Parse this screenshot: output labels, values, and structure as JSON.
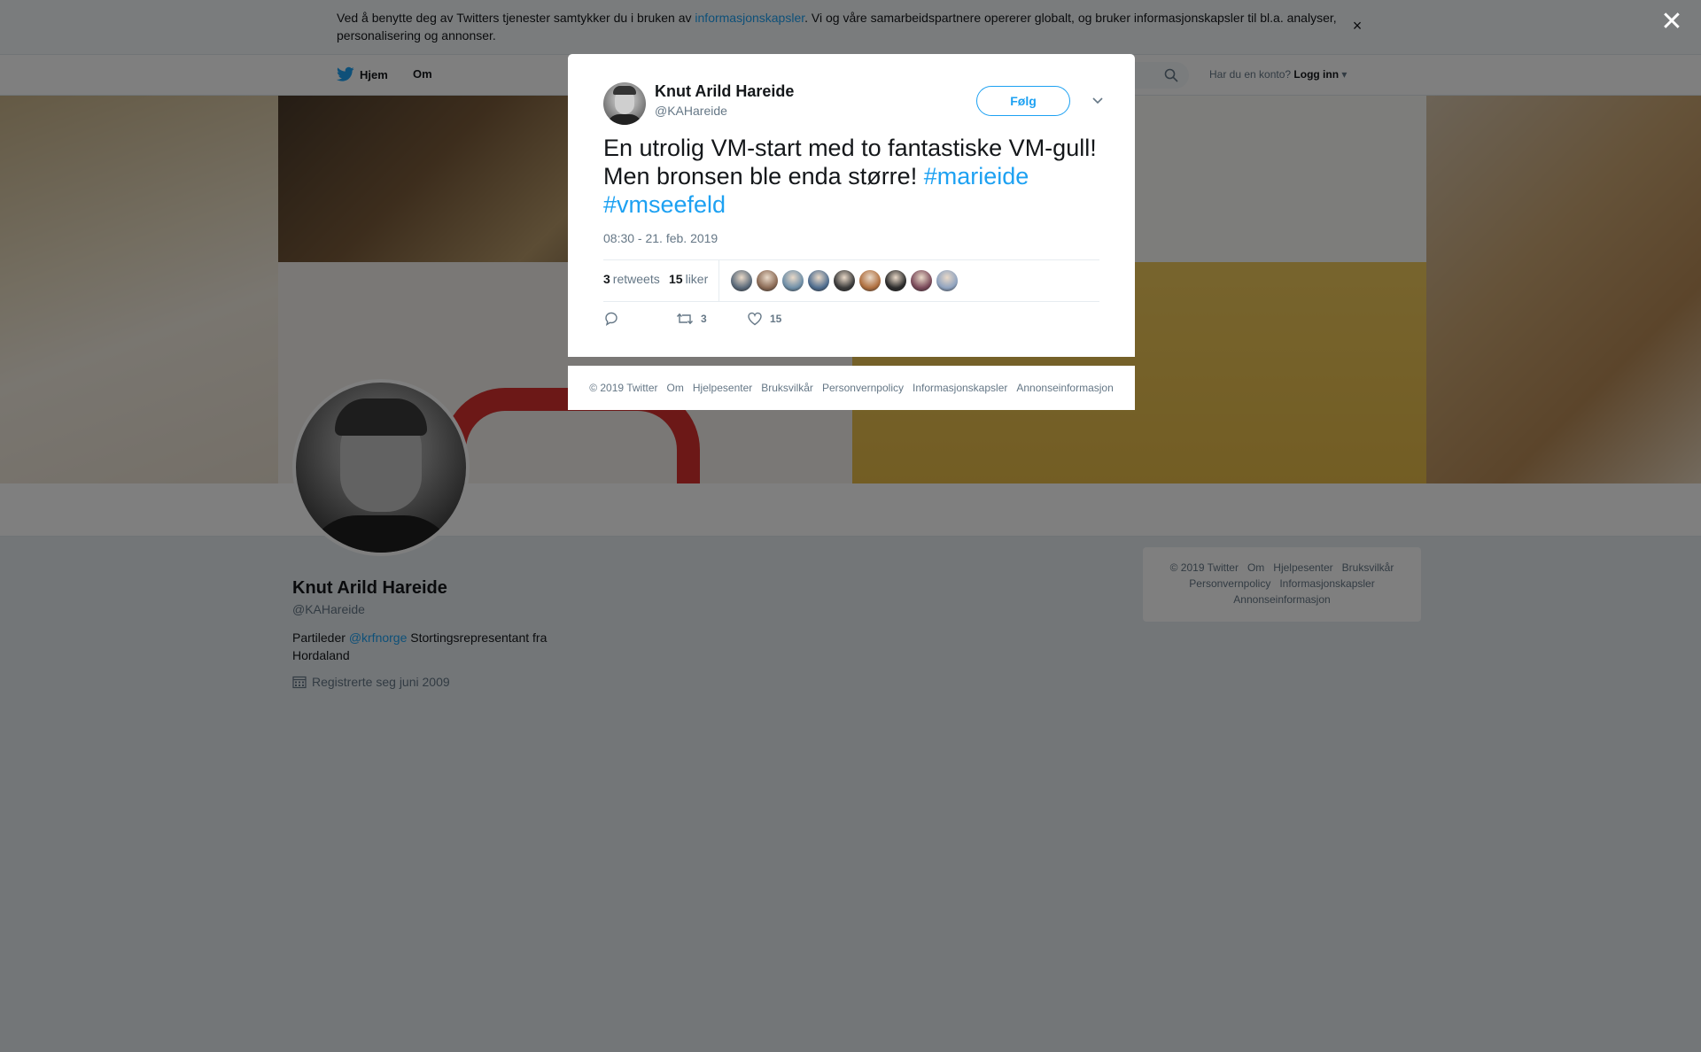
{
  "cookie_bar": {
    "text_before": "Ved å benytte deg av Twitters tjenester samtykker du i bruken av ",
    "link": "informasjonskapsler",
    "text_after": ". Vi og våre samarbeidspartnere opererer globalt, og bruker informasjonskapsler til bl.a. analyser, personalisering og annonser.",
    "close": "×"
  },
  "nav": {
    "home": "Hjem",
    "about": "Om",
    "account_prompt": "Har du en konto?",
    "login": "Logg inn"
  },
  "profile": {
    "name": "Knut Arild Hareide",
    "handle": "@KAHareide",
    "bio_before": "Partileder ",
    "bio_link": "@krfnorge",
    "bio_after": " Stortingsrepresentant fra Hordaland",
    "joined": "Registrerte seg juni 2009"
  },
  "side_footer": [
    "© 2019 Twitter",
    "Om",
    "Hjelpesenter",
    "Bruksvilkår",
    "Personvernpolicy",
    "Informasjonskapsler",
    "Annonseinformasjon"
  ],
  "overlay": {
    "close": "✕"
  },
  "tweet": {
    "author_name": "Knut Arild Hareide",
    "author_handle": "@KAHareide",
    "follow_label": "Følg",
    "text": "En utrolig VM-start med to fantastiske VM-gull! Men bronsen ble enda større! ",
    "hashtag1": "#marieide",
    "hashtag2": "#vmseefeld",
    "timestamp": "08:30 - 21. feb. 2019",
    "retweets_count": "3",
    "retweets_label": "retweets",
    "likes_count": "15",
    "likes_label": "liker",
    "action_retweets": "3",
    "action_likes": "15"
  },
  "liker_avatar_colors": [
    "#5b6a7a",
    "#8a6a55",
    "#6f8fa8",
    "#4f6d8f",
    "#3a3a3a",
    "#b07040",
    "#2b2b2b",
    "#7a4a5a",
    "#8fa3c0"
  ],
  "modal_footer": [
    "© 2019 Twitter",
    "Om",
    "Hjelpesenter",
    "Bruksvilkår",
    "Personvernpolicy",
    "Informasjonskapsler",
    "Annonseinformasjon"
  ],
  "colors": {
    "accent": "#1da1f2",
    "text": "#14171a",
    "secondary": "#657786"
  }
}
